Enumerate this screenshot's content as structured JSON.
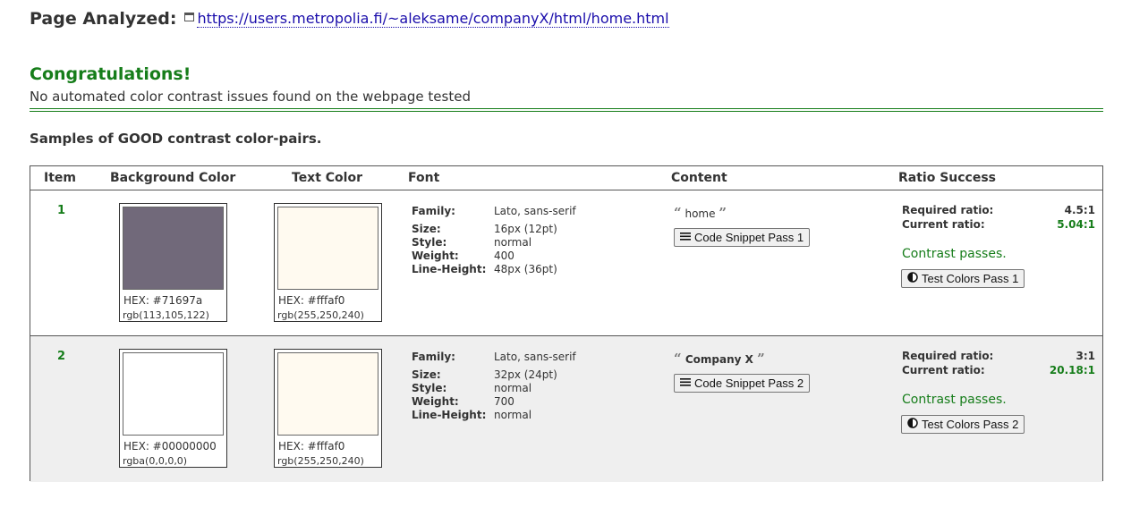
{
  "header": {
    "label": "Page Analyzed:",
    "url": "https://users.metropolia.fi/~aleksame/companyX/html/home.html"
  },
  "result": {
    "title": "Congratulations!",
    "subtitle": "No automated color contrast issues found on the webpage tested"
  },
  "samples_heading": "Samples of GOOD contrast color-pairs.",
  "table": {
    "columns": [
      "Item",
      "Background Color",
      "Text Color",
      "Font",
      "Content",
      "Ratio Success"
    ],
    "font_keys": {
      "family": "Family:",
      "size": "Size:",
      "style": "Style:",
      "weight": "Weight:",
      "line_height": "Line-Height:"
    },
    "ratio_keys": {
      "required": "Required ratio:",
      "current": "Current ratio:"
    },
    "rows": [
      {
        "item": "1",
        "bg": {
          "swatch": "#71697a",
          "hex": "HEX: #71697a",
          "rgb": "rgb(113,105,122)"
        },
        "text": {
          "swatch": "#fffaf0",
          "hex": "HEX: #fffaf0",
          "rgb": "rgb(255,250,240)"
        },
        "font": {
          "family": "Lato, sans-serif",
          "size": "16px (12pt)",
          "style": "normal",
          "weight": "400",
          "line_height": "48px (36pt)"
        },
        "content": "home",
        "snippet_button": "Code Snippet Pass 1",
        "required_ratio": "4.5:1",
        "current_ratio": "5.04:1",
        "status": "Contrast passes.",
        "test_button": "Test Colors Pass 1"
      },
      {
        "item": "2",
        "bg": {
          "swatch": "#ffffff",
          "hex": "HEX: #00000000",
          "rgb": "rgba(0,0,0,0)"
        },
        "text": {
          "swatch": "#fffaf0",
          "hex": "HEX: #fffaf0",
          "rgb": "rgb(255,250,240)"
        },
        "font": {
          "family": "Lato, sans-serif",
          "size": "32px (24pt)",
          "style": "normal",
          "weight": "700",
          "line_height": "normal"
        },
        "content": "Company X",
        "snippet_button": "Code Snippet Pass 2",
        "required_ratio": "3:1",
        "current_ratio": "20.18:1",
        "status": "Contrast passes.",
        "test_button": "Test Colors Pass 2"
      }
    ]
  },
  "colors": {
    "success_green": "#167d1a",
    "link_blue": "#1a0dab",
    "alt_row_bg": "#efefef"
  }
}
